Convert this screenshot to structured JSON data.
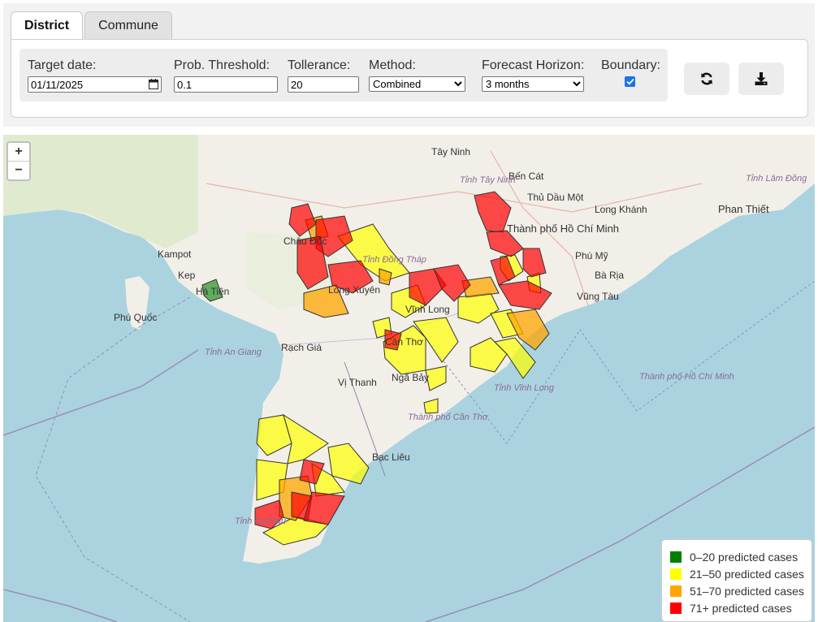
{
  "tabs": [
    {
      "label": "District",
      "active": true
    },
    {
      "label": "Commune",
      "active": false
    }
  ],
  "controls": {
    "target_date": {
      "label": "Target date:",
      "value": "01/11/2025"
    },
    "prob_threshold": {
      "label": "Prob. Threshold:",
      "value": "0.1"
    },
    "tollerance": {
      "label": "Tollerance:",
      "value": "20"
    },
    "method": {
      "label": "Method:",
      "value": "Combined"
    },
    "forecast_horizon": {
      "label": "Forecast Horizon:",
      "value": "3 months"
    },
    "boundary": {
      "label": "Boundary:",
      "checked": true
    }
  },
  "buttons": {
    "refresh_icon": "refresh-icon",
    "download_icon": "download-icon"
  },
  "map": {
    "zoom_in": "+",
    "zoom_out": "−",
    "labels": {
      "tay_ninh": "Tây Ninh",
      "ben_cat": "Bến Cát",
      "thu_dau_mot": "Thủ Dầu Một",
      "tinh_tay_ninh": "Tỉnh Tây Ninh",
      "tp_hcm": "Thành phố Hồ Chí Minh",
      "long_khanh": "Long Khánh",
      "phan_thiet": "Phan Thiết",
      "tinh_lam_dong": "Tỉnh Lâm Đồng",
      "phu_my": "Phú Mỹ",
      "ba_ria": "Bà Rịa",
      "vung_tau": "Vũng Tàu",
      "phu_quoc": "Phú Quốc",
      "ha_tien": "Hà Tiên",
      "rach_gia": "Rạch Giá",
      "tinh_an_giang": "Tỉnh An Giang",
      "tinh_dong_thap": "Tỉnh Đồng Tháp",
      "long_xuyen": "Long Xuyên",
      "vi_thanh": "Vị Thanh",
      "nga_bay": "Ngã Bảy",
      "tp_can_tho": "Thành phố Cần Thơ",
      "tinh_vinh_long": "Tỉnh Vĩnh Long",
      "tp_hcm_sea": "Thành phố Hồ Chí Minh",
      "bac_lieu": "Bạc Liêu",
      "tinh_ca_mau": "Tỉnh Cà Mau",
      "kampot": "Kampot",
      "kep": "Kep",
      "can_tho": "Cần Thơ",
      "vinh_long": "Vĩnh Long",
      "chau_doc": "Châu Đốc"
    }
  },
  "legend": [
    {
      "label": "0–20 predicted cases",
      "color": "#008000"
    },
    {
      "label": "21–50 predicted cases",
      "color": "#ffff00"
    },
    {
      "label": "51–70 predicted cases",
      "color": "#ffa500"
    },
    {
      "label": "71+ predicted cases",
      "color": "#ff0000"
    }
  ]
}
